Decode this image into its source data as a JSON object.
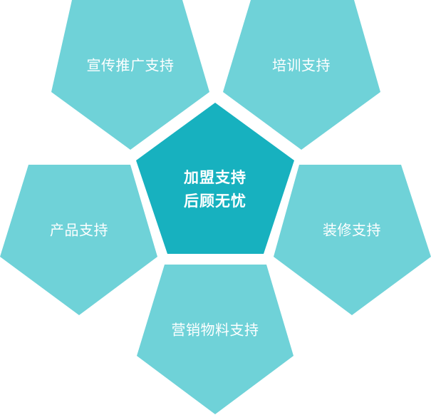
{
  "center": {
    "line1": "加盟支持",
    "line2": "后顾无忧"
  },
  "petals": [
    {
      "key": "publicity",
      "label": "宣传推广支持"
    },
    {
      "key": "training",
      "label": "培训支持"
    },
    {
      "key": "product",
      "label": "产品支持"
    },
    {
      "key": "decoration",
      "label": "装修支持"
    },
    {
      "key": "marketing",
      "label": "营销物料支持"
    }
  ],
  "colors": {
    "outer": "#6fd2d8",
    "center": "#17b1bf",
    "text": "#ffffff"
  }
}
